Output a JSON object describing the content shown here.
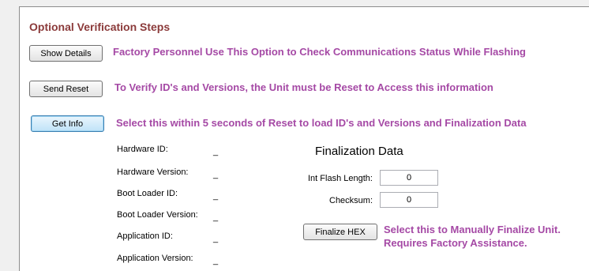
{
  "section_title": "Optional Verification Steps",
  "actions": {
    "show_details": {
      "label": "Show Details",
      "description": "Factory Personnel Use This Option to Check Communications Status While Flashing"
    },
    "send_reset": {
      "label": "Send Reset",
      "description": "To Verify ID's and Versions, the Unit must be Reset to Access this information"
    },
    "get_info": {
      "label": "Get Info",
      "description": "Select this within 5 seconds of Reset to load ID's and Versions and Finalization Data"
    }
  },
  "info_fields": [
    {
      "label": "Hardware ID:",
      "value": "_"
    },
    {
      "label": "Hardware Version:",
      "value": "_"
    },
    {
      "label": "Boot Loader ID:",
      "value": "_"
    },
    {
      "label": "Boot Loader Version:",
      "value": "_"
    },
    {
      "label": "Application ID:",
      "value": "_"
    },
    {
      "label": "Application Version:",
      "value": "_"
    }
  ],
  "finalization": {
    "title": "Finalization Data",
    "int_flash_length": {
      "label": "Int Flash Length:",
      "value": "0"
    },
    "checksum": {
      "label": "Checksum:",
      "value": "0"
    },
    "finalize_button": "Finalize HEX",
    "finalize_description": "Select this to Manually Finalize Unit. Requires Factory Assistance."
  },
  "colors": {
    "title": "#8b3a3a",
    "description": "#a549a5",
    "panel_background": "#ffffff",
    "window_background": "#f0f0f0"
  }
}
